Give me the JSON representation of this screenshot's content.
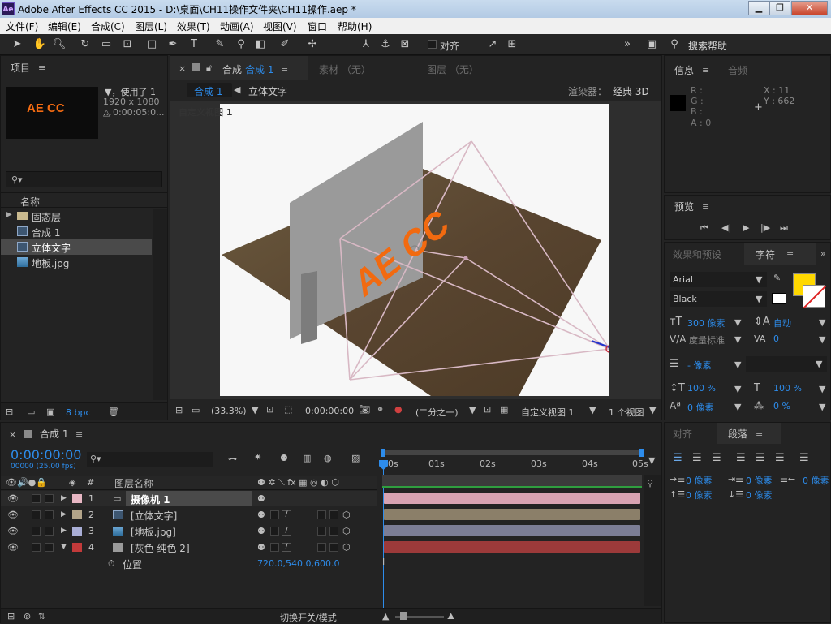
{
  "titlebar": {
    "title": "Adobe After Effects CC 2015 - D:\\桌面\\CH11操作文件夹\\CH11操作.aep *",
    "app_icon": "Ae",
    "minimize": "▁",
    "restore": "❐",
    "close": "✕"
  },
  "menu": [
    "文件(F)",
    "编辑(E)",
    "合成(C)",
    "图层(L)",
    "效果(T)",
    "动画(A)",
    "视图(V)",
    "窗口",
    "帮助(H)"
  ],
  "toolbar": {
    "snap_label": "对齐",
    "search_label": "搜索帮助"
  },
  "project": {
    "tab": "项目",
    "thumb_text": "AE CC",
    "used": "▼，使用了 1",
    "dims": "1920 x 1080 ...",
    "duration": "△ 0:00:05:0...",
    "col_name": "名称",
    "items": [
      "固态层",
      "合成 1",
      "立体文字",
      "地板.jpg"
    ],
    "bpc": "8 bpc"
  },
  "viewer": {
    "tab_comp": "合成",
    "tab_comp_name": "合成 1",
    "tab_footage": "素材 （无）",
    "tab_layer": "图层 （无）",
    "crumb_active": "合成 1",
    "crumb_next": "立体文字",
    "renderer_label": "渲染器：",
    "renderer_value": "经典 3D",
    "view_label": "自定义视图 1",
    "zoom": "(33.3%)",
    "timecode": "0:00:00:00",
    "resolution": "(二分之一)",
    "view_select": "自定义视图 1",
    "views_count": "1 个视图",
    "scene_text": "AE CC"
  },
  "info": {
    "tab_info": "信息",
    "tab_audio": "音频",
    "r": "R :",
    "g": "G :",
    "b": "B :",
    "a": "A : 0",
    "x": "X : 11",
    "y": "Y : 662"
  },
  "preview": {
    "tab": "预览"
  },
  "character": {
    "tab_effects": "效果和预设",
    "tab_char": "字符",
    "font": "Arial",
    "style": "Black",
    "font_size": "300 像素",
    "leading": "自动",
    "kerning": "度量标准",
    "tracking": "0",
    "stroke": "- 像素",
    "vscale": "100 %",
    "hscale": "100 %",
    "baseline": "0 像素",
    "tsume": "0 %",
    "fill_color": "#ffd800"
  },
  "paragraph": {
    "tab_align": "对齐",
    "tab_para": "段落",
    "indent_left": "0 像素",
    "indent_right": "0 像素",
    "indent_first": "0 像素",
    "space_before": "0 像素",
    "space_after": "0 像素"
  },
  "timeline": {
    "tab": "合成 1",
    "timecode": "0:00:00:00",
    "frames": "00000 (25.00 fps)",
    "col_hash": "#",
    "col_layer": "图层名称",
    "ruler": [
      "00s",
      "01s",
      "02s",
      "03s",
      "04s",
      "05s"
    ],
    "layers": [
      {
        "num": "1",
        "name": "摄像机 1",
        "label_color": "#e8b7c4",
        "bar_color": "#d8a3b2"
      },
      {
        "num": "2",
        "name": "[立体文字]",
        "label_color": "#b3a58a",
        "bar_color": "#8b7f69"
      },
      {
        "num": "3",
        "name": "[地板.jpg]",
        "label_color": "#a9aed6",
        "bar_color": "#7b7d95"
      },
      {
        "num": "4",
        "name": "[灰色 纯色 2]",
        "label_color": "#c23a3a",
        "bar_color": "#9c3a3a"
      }
    ],
    "prop_name": "位置",
    "prop_value": "720.0,540.0,600.0",
    "footer_label": "切换开关/模式"
  }
}
